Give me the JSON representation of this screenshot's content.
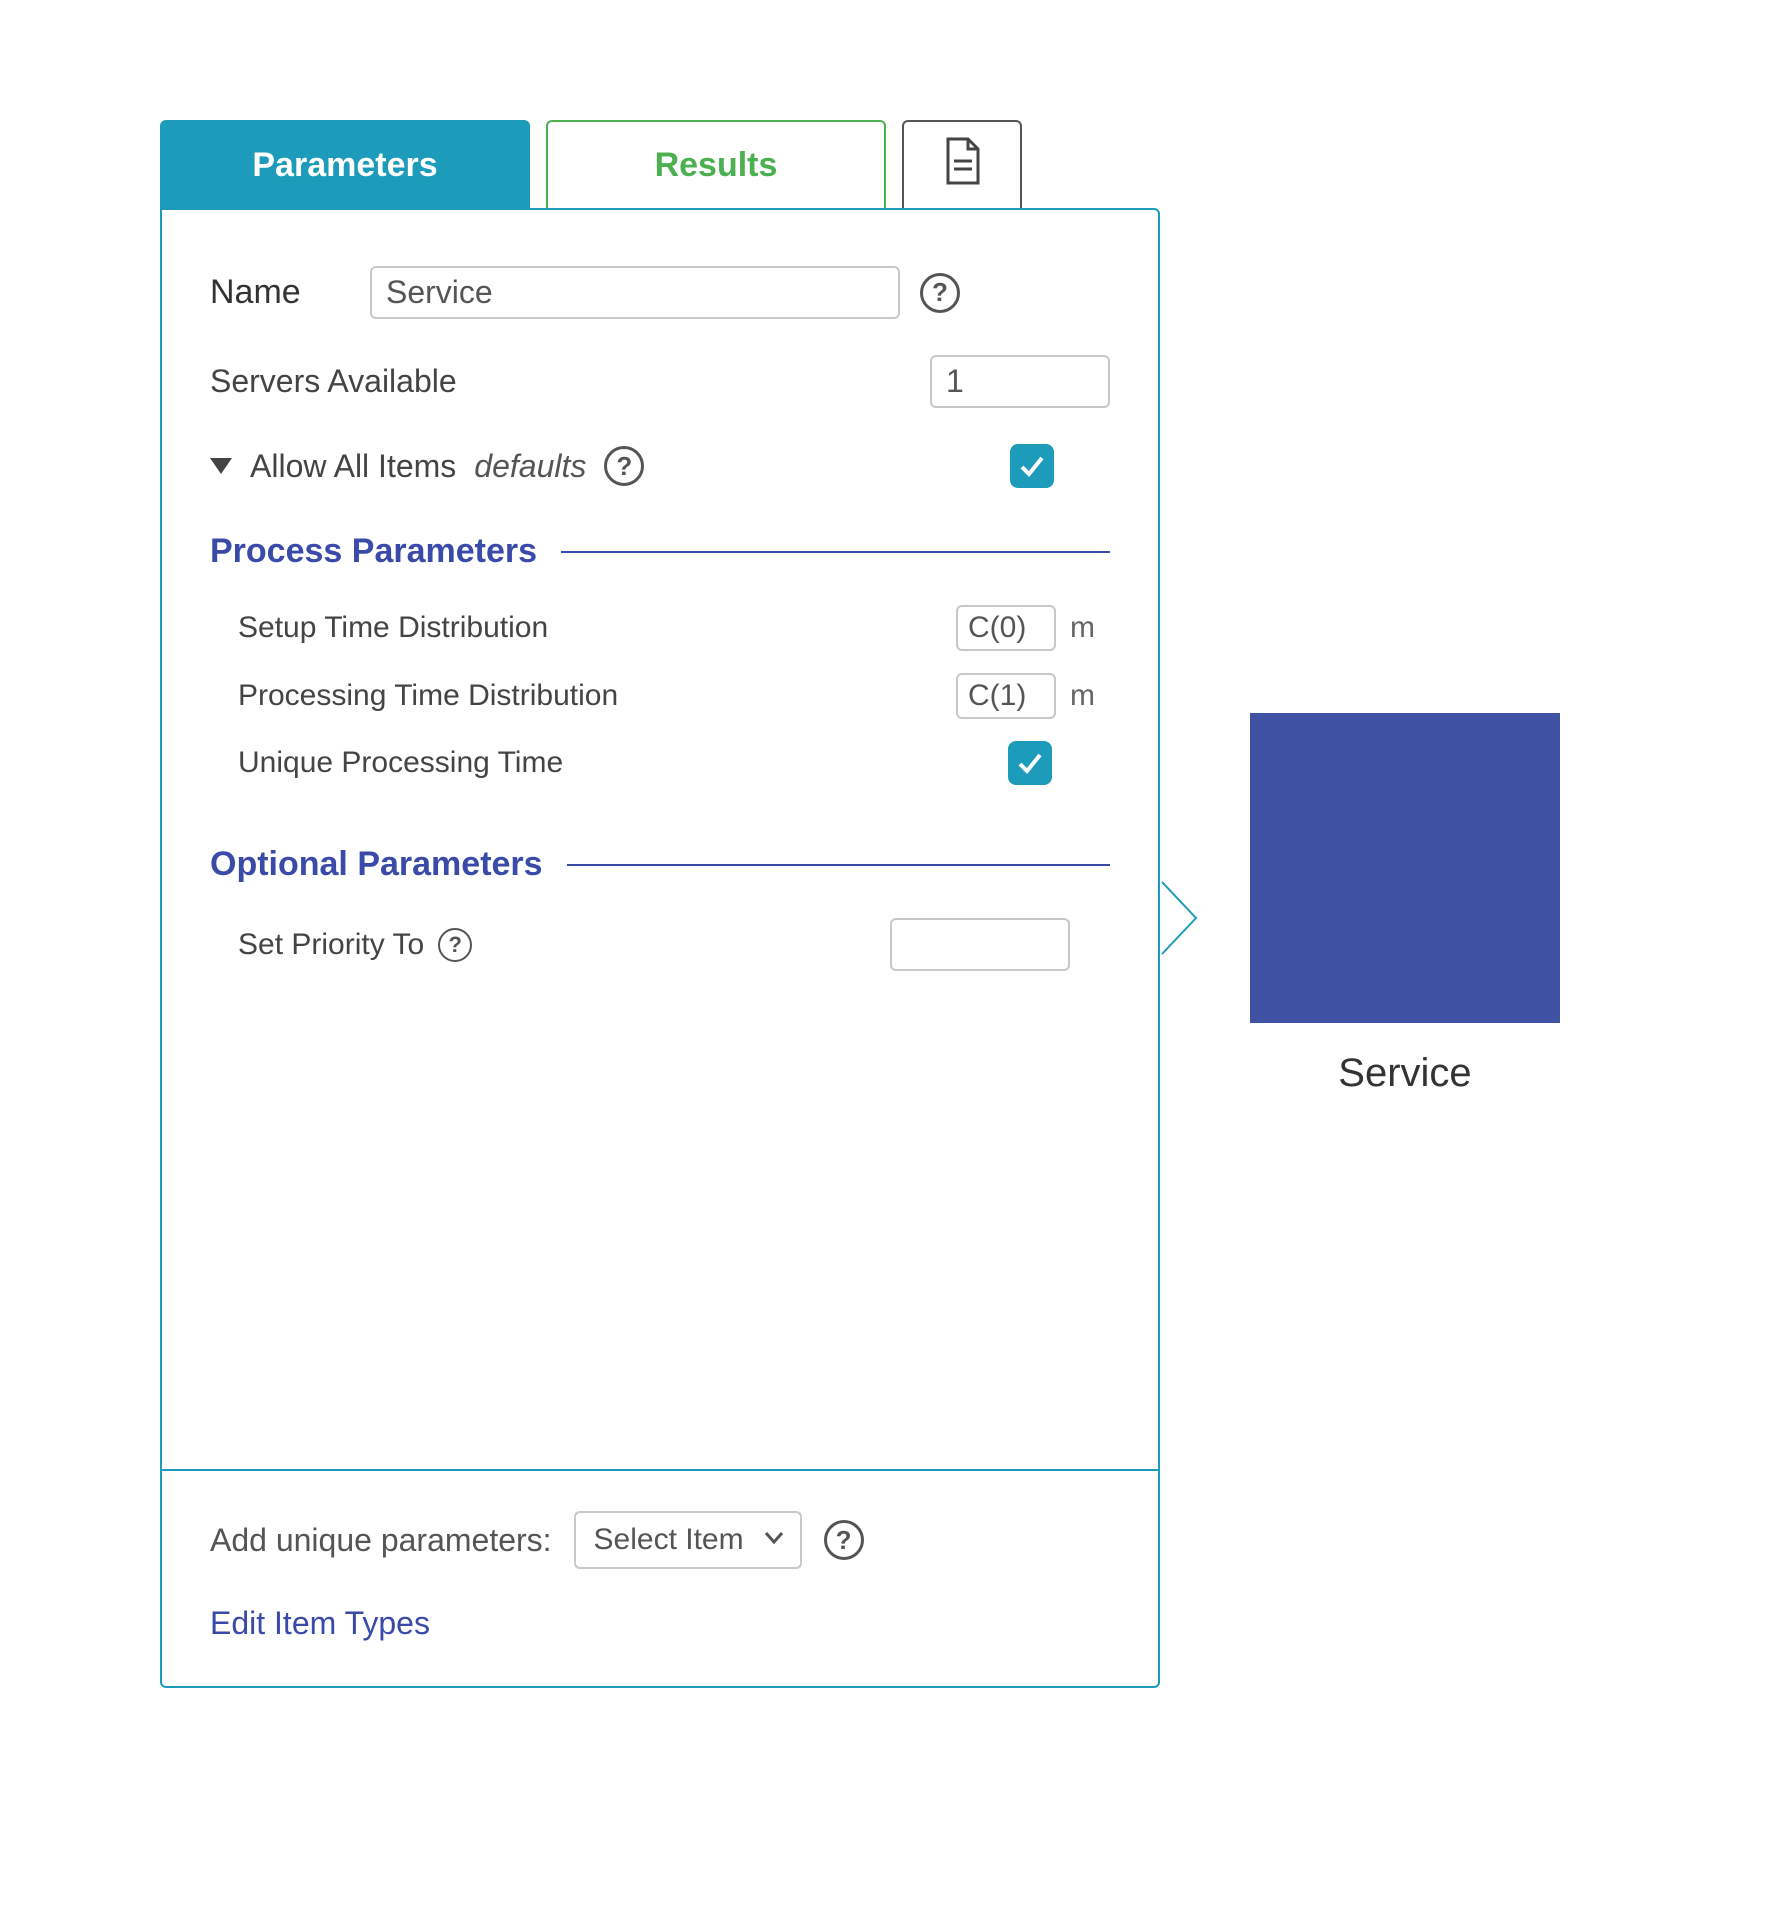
{
  "tabs": {
    "parameters": "Parameters",
    "results": "Results"
  },
  "fields": {
    "name_label": "Name",
    "name_value": "Service",
    "servers_available_label": "Servers Available",
    "servers_available_value": "1",
    "allow_all_items_label": "Allow All Items",
    "allow_all_defaults": "defaults",
    "allow_all_checked": true
  },
  "sections": {
    "process": {
      "title": "Process Parameters",
      "setup_time_label": "Setup Time Distribution",
      "setup_time_value": "C(0)",
      "setup_time_unit": "m",
      "processing_time_label": "Processing Time Distribution",
      "processing_time_value": "C(1)",
      "processing_time_unit": "m",
      "unique_processing_label": "Unique Processing Time",
      "unique_processing_checked": true
    },
    "optional": {
      "title": "Optional Parameters",
      "set_priority_label": "Set Priority To",
      "set_priority_value": ""
    }
  },
  "footer": {
    "add_unique_label": "Add unique parameters:",
    "select_item": "Select Item",
    "edit_item_types": "Edit Item Types"
  },
  "node": {
    "label": "Service"
  }
}
